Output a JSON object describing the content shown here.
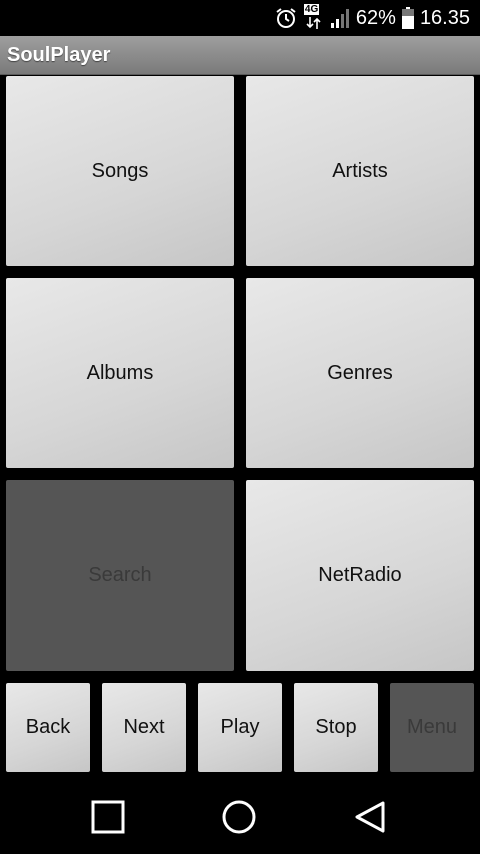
{
  "status_bar": {
    "network_label": "4G",
    "battery_percent": "62%",
    "time": "16.35",
    "icons": [
      "alarm-icon",
      "data-arrows-icon",
      "signal-icon",
      "battery-icon"
    ]
  },
  "app": {
    "title": "SoulPlayer"
  },
  "tiles": {
    "songs": "Songs",
    "artists": "Artists",
    "albums": "Albums",
    "genres": "Genres",
    "search": "Search",
    "netradio": "NetRadio"
  },
  "controls": {
    "back": "Back",
    "next": "Next",
    "play": "Play",
    "stop": "Stop",
    "menu": "Menu"
  },
  "nav": {
    "icons": [
      "recent-apps-icon",
      "home-icon",
      "back-icon"
    ]
  },
  "colors": {
    "tile_light": "#d6d6d6",
    "tile_disabled": "#555555",
    "title_bar": "#8a8a8a",
    "background": "#000000"
  }
}
